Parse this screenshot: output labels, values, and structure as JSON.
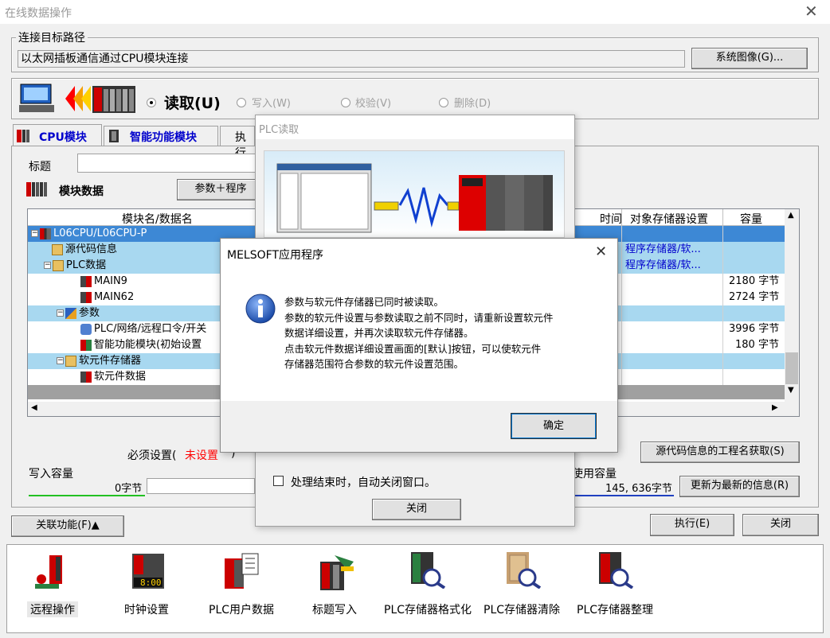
{
  "window": {
    "title": "在线数据操作"
  },
  "connection": {
    "legend": "连接目标路径",
    "path_text": "以太网插板通信通过CPU模块连接",
    "system_image_button": "系统图像(G)..."
  },
  "mode": {
    "read": "读取(U)",
    "write": "写入(W)",
    "verify": "校验(V)",
    "delete": "删除(D)"
  },
  "tabs": {
    "cpu": "CPU模块",
    "intelligent": "智能功能模块",
    "execute": "执行"
  },
  "title_label": "标题",
  "module_data_label": "模块数据",
  "param_program_button": "参数＋程序",
  "table": {
    "headers": {
      "name": "模块名/数据名",
      "time": "时间",
      "target": "对象存储器设置",
      "capacity": "容量"
    },
    "rows": [
      {
        "name": "L06CPU/L06CPU-P",
        "target": "",
        "capacity": ""
      },
      {
        "name": "源代码信息",
        "target": "程序存储器/软...",
        "capacity": ""
      },
      {
        "name": "PLC数据",
        "target": "程序存储器/软...",
        "capacity": ""
      },
      {
        "name": "MAIN9",
        "target": "",
        "capacity": "2180 字节"
      },
      {
        "name": "MAIN62",
        "target": "",
        "capacity": "2724 字节"
      },
      {
        "name": "参数",
        "target": "",
        "capacity": ""
      },
      {
        "name": "PLC/网络/远程口令/开关",
        "target": "",
        "capacity": "3996 字节"
      },
      {
        "name": "智能功能模块(初始设置",
        "target": "",
        "capacity": "180 字节"
      },
      {
        "name": "软元件存储器",
        "target": "",
        "capacity": ""
      },
      {
        "name": "软元件数据",
        "target": "",
        "capacity": ""
      }
    ]
  },
  "required_setting": {
    "label": "必须设置(",
    "value": "未设置",
    "close_paren": ")"
  },
  "source_info_button": "源代码信息的工程名获取(S)",
  "write_capacity": {
    "label": "写入容量",
    "value": "0字节"
  },
  "used_capacity": {
    "label": "使用容量",
    "value": "145, 636字节"
  },
  "refresh_button": "更新为最新的信息(R)",
  "related_button": "关联功能(F)▲",
  "execute_button": "执行(E)",
  "close_button": "关闭",
  "toolbar_items": [
    "远程操作",
    "时钟设置",
    "PLC用户数据",
    "标题写入",
    "PLC存储器格式化",
    "PLC存储器清除",
    "PLC存储器整理"
  ],
  "clock_display": "8:00",
  "plc_read_dialog": {
    "title": "PLC读取",
    "auto_close_label": "处理结束时，自动关闭窗口。",
    "close_button": "关闭"
  },
  "msg_dialog": {
    "title": "MELSOFT应用程序",
    "lines": [
      "参数与软元件存储器已同时被读取。",
      "参数的软元件设置与参数读取之前不同时，请重新设置软元件",
      "数据详细设置，并再次读取软元件存储器。",
      "点击软元件数据详细设置画面的[默认]按钮，可以使软元件",
      "存储器范围符合参数的软元件设置范围。"
    ],
    "ok_button": "确定"
  },
  "colors": {
    "selected_row": "#3d88d5",
    "highlight_row": "#a8d8f0",
    "link_blue": "#0000cc",
    "alert_red": "#ff0000"
  }
}
